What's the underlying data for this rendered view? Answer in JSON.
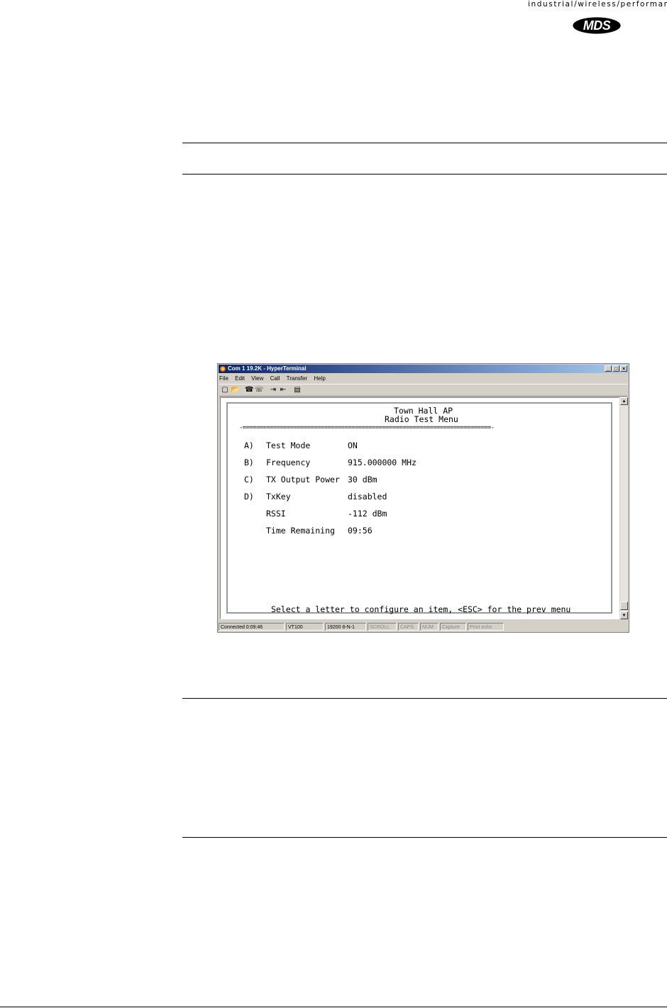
{
  "header": {
    "tagline": "industrial/wireless/performance",
    "logo_text": "MDS"
  },
  "window": {
    "title": "Com 1 19.2K - HyperTerminal",
    "controls": {
      "minimize": "_",
      "maximize": "□",
      "close": "×"
    },
    "menu": [
      "File",
      "Edit",
      "View",
      "Call",
      "Transfer",
      "Help"
    ],
    "toolbar_icons": [
      "new-icon",
      "open-icon",
      "connect-icon",
      "disconnect-icon",
      "send-icon",
      "receive-icon",
      "properties-icon"
    ]
  },
  "terminal": {
    "device_name": "Town Hall AP",
    "menu_title": "Radio Test Menu",
    "separator": "-=========================================================================-",
    "items": [
      {
        "key": "A)",
        "label": "Test Mode",
        "value": "ON"
      },
      {
        "key": "B)",
        "label": "Frequency",
        "value": "915.000000 MHz"
      },
      {
        "key": "C)",
        "label": "TX Output Power",
        "value": "30 dBm"
      },
      {
        "key": "D)",
        "label": "TxKey",
        "value": "disabled"
      },
      {
        "key": "",
        "label": "RSSI",
        "value": "-112 dBm"
      },
      {
        "key": "",
        "label": "Time Remaining",
        "value": "09:56"
      }
    ],
    "prompt": "Select a letter to configure an item, <ESC> for the prev menu"
  },
  "statusbar": {
    "connected": "Connected 0:09:46",
    "emulation": "VT100",
    "port_settings": "19200 8-N-1",
    "scroll": "SCROLL",
    "caps": "CAPS",
    "num": "NUM",
    "capture": "Capture",
    "print_echo": "Print echo"
  }
}
